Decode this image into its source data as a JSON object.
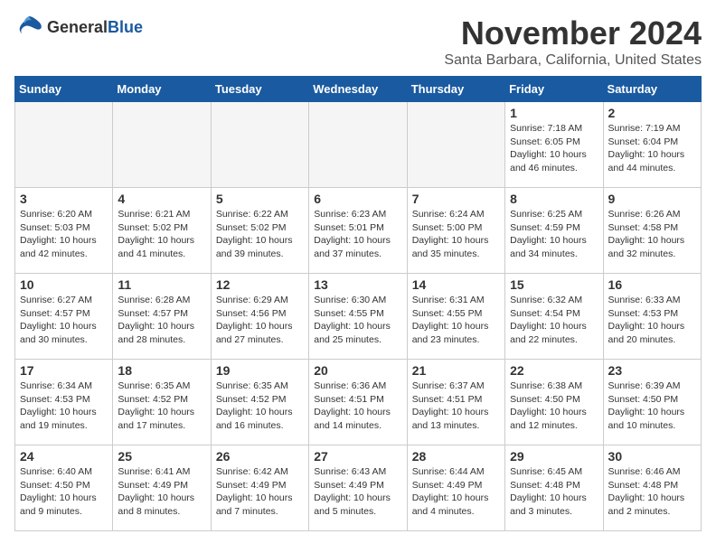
{
  "header": {
    "logo_general": "General",
    "logo_blue": "Blue",
    "month_title": "November 2024",
    "location": "Santa Barbara, California, United States"
  },
  "calendar": {
    "days_of_week": [
      "Sunday",
      "Monday",
      "Tuesday",
      "Wednesday",
      "Thursday",
      "Friday",
      "Saturday"
    ],
    "weeks": [
      [
        {
          "day": "",
          "info": ""
        },
        {
          "day": "",
          "info": ""
        },
        {
          "day": "",
          "info": ""
        },
        {
          "day": "",
          "info": ""
        },
        {
          "day": "",
          "info": ""
        },
        {
          "day": "1",
          "info": "Sunrise: 7:18 AM\nSunset: 6:05 PM\nDaylight: 10 hours\nand 46 minutes."
        },
        {
          "day": "2",
          "info": "Sunrise: 7:19 AM\nSunset: 6:04 PM\nDaylight: 10 hours\nand 44 minutes."
        }
      ],
      [
        {
          "day": "3",
          "info": "Sunrise: 6:20 AM\nSunset: 5:03 PM\nDaylight: 10 hours\nand 42 minutes."
        },
        {
          "day": "4",
          "info": "Sunrise: 6:21 AM\nSunset: 5:02 PM\nDaylight: 10 hours\nand 41 minutes."
        },
        {
          "day": "5",
          "info": "Sunrise: 6:22 AM\nSunset: 5:02 PM\nDaylight: 10 hours\nand 39 minutes."
        },
        {
          "day": "6",
          "info": "Sunrise: 6:23 AM\nSunset: 5:01 PM\nDaylight: 10 hours\nand 37 minutes."
        },
        {
          "day": "7",
          "info": "Sunrise: 6:24 AM\nSunset: 5:00 PM\nDaylight: 10 hours\nand 35 minutes."
        },
        {
          "day": "8",
          "info": "Sunrise: 6:25 AM\nSunset: 4:59 PM\nDaylight: 10 hours\nand 34 minutes."
        },
        {
          "day": "9",
          "info": "Sunrise: 6:26 AM\nSunset: 4:58 PM\nDaylight: 10 hours\nand 32 minutes."
        }
      ],
      [
        {
          "day": "10",
          "info": "Sunrise: 6:27 AM\nSunset: 4:57 PM\nDaylight: 10 hours\nand 30 minutes."
        },
        {
          "day": "11",
          "info": "Sunrise: 6:28 AM\nSunset: 4:57 PM\nDaylight: 10 hours\nand 28 minutes."
        },
        {
          "day": "12",
          "info": "Sunrise: 6:29 AM\nSunset: 4:56 PM\nDaylight: 10 hours\nand 27 minutes."
        },
        {
          "day": "13",
          "info": "Sunrise: 6:30 AM\nSunset: 4:55 PM\nDaylight: 10 hours\nand 25 minutes."
        },
        {
          "day": "14",
          "info": "Sunrise: 6:31 AM\nSunset: 4:55 PM\nDaylight: 10 hours\nand 23 minutes."
        },
        {
          "day": "15",
          "info": "Sunrise: 6:32 AM\nSunset: 4:54 PM\nDaylight: 10 hours\nand 22 minutes."
        },
        {
          "day": "16",
          "info": "Sunrise: 6:33 AM\nSunset: 4:53 PM\nDaylight: 10 hours\nand 20 minutes."
        }
      ],
      [
        {
          "day": "17",
          "info": "Sunrise: 6:34 AM\nSunset: 4:53 PM\nDaylight: 10 hours\nand 19 minutes."
        },
        {
          "day": "18",
          "info": "Sunrise: 6:35 AM\nSunset: 4:52 PM\nDaylight: 10 hours\nand 17 minutes."
        },
        {
          "day": "19",
          "info": "Sunrise: 6:35 AM\nSunset: 4:52 PM\nDaylight: 10 hours\nand 16 minutes."
        },
        {
          "day": "20",
          "info": "Sunrise: 6:36 AM\nSunset: 4:51 PM\nDaylight: 10 hours\nand 14 minutes."
        },
        {
          "day": "21",
          "info": "Sunrise: 6:37 AM\nSunset: 4:51 PM\nDaylight: 10 hours\nand 13 minutes."
        },
        {
          "day": "22",
          "info": "Sunrise: 6:38 AM\nSunset: 4:50 PM\nDaylight: 10 hours\nand 12 minutes."
        },
        {
          "day": "23",
          "info": "Sunrise: 6:39 AM\nSunset: 4:50 PM\nDaylight: 10 hours\nand 10 minutes."
        }
      ],
      [
        {
          "day": "24",
          "info": "Sunrise: 6:40 AM\nSunset: 4:50 PM\nDaylight: 10 hours\nand 9 minutes."
        },
        {
          "day": "25",
          "info": "Sunrise: 6:41 AM\nSunset: 4:49 PM\nDaylight: 10 hours\nand 8 minutes."
        },
        {
          "day": "26",
          "info": "Sunrise: 6:42 AM\nSunset: 4:49 PM\nDaylight: 10 hours\nand 7 minutes."
        },
        {
          "day": "27",
          "info": "Sunrise: 6:43 AM\nSunset: 4:49 PM\nDaylight: 10 hours\nand 5 minutes."
        },
        {
          "day": "28",
          "info": "Sunrise: 6:44 AM\nSunset: 4:49 PM\nDaylight: 10 hours\nand 4 minutes."
        },
        {
          "day": "29",
          "info": "Sunrise: 6:45 AM\nSunset: 4:48 PM\nDaylight: 10 hours\nand 3 minutes."
        },
        {
          "day": "30",
          "info": "Sunrise: 6:46 AM\nSunset: 4:48 PM\nDaylight: 10 hours\nand 2 minutes."
        }
      ]
    ]
  }
}
